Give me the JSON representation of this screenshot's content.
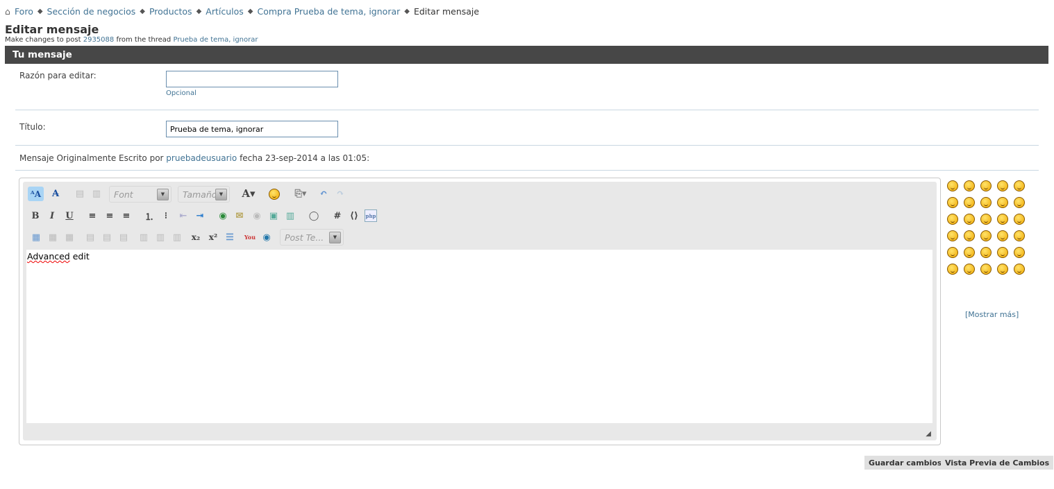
{
  "breadcrumb": [
    "Foro",
    "Sección de negocios",
    "Productos",
    "Artículos",
    "Compra Prueba de tema, ignorar",
    "Editar mensaje"
  ],
  "page": {
    "title": "Editar mensaje",
    "sub_prefix": "Make changes to post",
    "post_id": "2935088",
    "sub_mid": "from the thread",
    "thread": "Prueba de tema, ignorar"
  },
  "section": {
    "title": "Tu mensaje"
  },
  "form": {
    "reason_label": "Razón para editar:",
    "reason_value": "",
    "reason_hint": "Opcional",
    "title_label": "Título:",
    "title_value": "Prueba de tema, ignorar"
  },
  "quote": {
    "prefix": "Mensaje Originalmente Escrito por",
    "user": "pruebadeusuario",
    "suffix": "fecha 23-sep-2014 a las 01:05:"
  },
  "editor": {
    "font_placeholder": "Font",
    "size_placeholder": "Tamaño",
    "post_template": "Post Te...",
    "content_word1": "Advanced",
    "content_rest": " edit"
  },
  "smilies": {
    "more_label": "[Mostrar más]",
    "count": 30
  },
  "buttons": {
    "save": "Guardar cambios",
    "preview": "Vista Previa de Cambios"
  }
}
